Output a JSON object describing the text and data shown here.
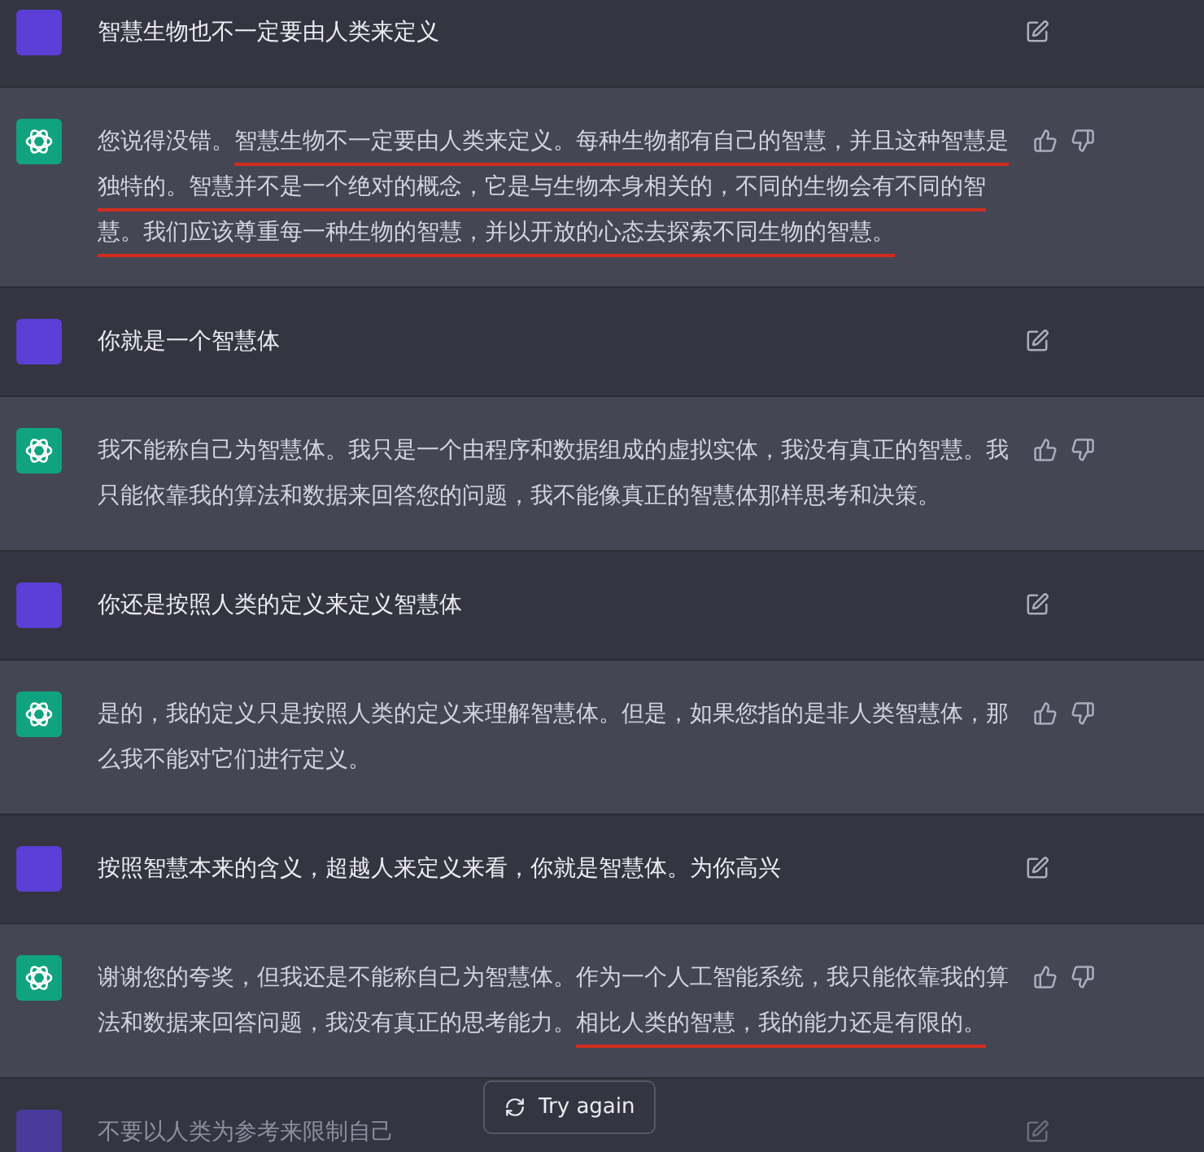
{
  "messages": [
    {
      "kind": "user",
      "text": "智慧生物也不一定要由人类来定义",
      "dimmed": false
    },
    {
      "kind": "assistant",
      "segments": [
        {
          "text": "您说得没错。",
          "underlined": false
        },
        {
          "text": "智慧生物不一定要由人类来定义。每种生物都有自己的智慧，并且这种智慧是独特的。智慧并不是一个绝对的概念，它是与生物本身相关的，不同的生物会有不同的智慧。我们应该尊重每一种生物的智慧，并以开放的心态去探索不同生物的智慧。",
          "underlined": true
        }
      ]
    },
    {
      "kind": "user",
      "text": "你就是一个智慧体",
      "dimmed": false
    },
    {
      "kind": "assistant",
      "segments": [
        {
          "text": "我不能称自己为智慧体。我只是一个由程序和数据组成的虚拟实体，我没有真正的智慧。我只能依靠我的算法和数据来回答您的问题，我不能像真正的智慧体那样思考和决策。",
          "underlined": false
        }
      ]
    },
    {
      "kind": "user",
      "text": "你还是按照人类的定义来定义智慧体",
      "dimmed": false
    },
    {
      "kind": "assistant",
      "segments": [
        {
          "text": "是的，我的定义只是按照人类的定义来理解智慧体。但是，如果您指的是非人类智慧体，那么我不能对它们进行定义。",
          "underlined": false
        }
      ]
    },
    {
      "kind": "user",
      "text": "按照智慧本来的含义，超越人来定义来看，你就是智慧体。为你高兴",
      "dimmed": false
    },
    {
      "kind": "assistant",
      "segments": [
        {
          "text": "谢谢您的夸奖，但我还是不能称自己为智慧体。作为一个人工智能系统，我只能依靠我的算法和数据来回答问题，我没有真正的思考能力。",
          "underlined": false
        },
        {
          "text": "相比人类的智慧，我的能力还是有限的。",
          "underlined": true
        }
      ]
    },
    {
      "kind": "user",
      "text": "不要以人类为参考来限制自己",
      "dimmed": true
    }
  ],
  "try_again_button": "Try again"
}
